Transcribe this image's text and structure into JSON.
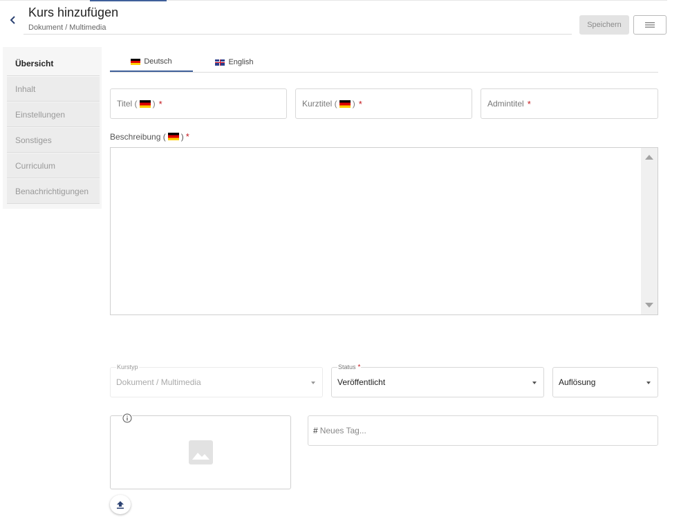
{
  "header": {
    "title": "Kurs hinzufügen",
    "subtitle": "Dokument / Multimedia",
    "save_label": "Speichern"
  },
  "sidebar": {
    "items": [
      {
        "label": "Übersicht",
        "active": true
      },
      {
        "label": "Inhalt"
      },
      {
        "label": "Einstellungen"
      },
      {
        "label": "Sonstiges"
      },
      {
        "label": "Curriculum"
      },
      {
        "label": "Benachrichtigungen"
      }
    ]
  },
  "tabs": [
    {
      "label": "Deutsch",
      "flag": "flag-de-icon",
      "active": true
    },
    {
      "label": "English",
      "flag": "flag-uk-icon"
    }
  ],
  "fields": {
    "titel": {
      "label_pre": "Titel (",
      "label_post": ")"
    },
    "kurztitel": {
      "label_pre": "Kurztitel (",
      "label_post": ")"
    },
    "admintitel": {
      "label": "Admintitel"
    },
    "required_mark": "*"
  },
  "description": {
    "label_pre": "Beschreibung (",
    "label_post": ")"
  },
  "selects": {
    "kurstyp": {
      "label": "Kurstyp",
      "value": "Dokument / Multimedia",
      "disabled": true
    },
    "status": {
      "label": "Status",
      "value": "Veröffentlicht"
    },
    "aufloesung": {
      "value": "Auflösung"
    }
  },
  "tags": {
    "prefix": "#",
    "placeholder": "Neues Tag..."
  },
  "icons": {
    "back": "chevron-left-icon",
    "menu": "hamburger-menu-icon",
    "info": "info-icon",
    "image": "image-placeholder-icon",
    "upload": "upload-icon"
  },
  "colors": {
    "accent": "#3f5f9a",
    "required": "#c4161c"
  }
}
